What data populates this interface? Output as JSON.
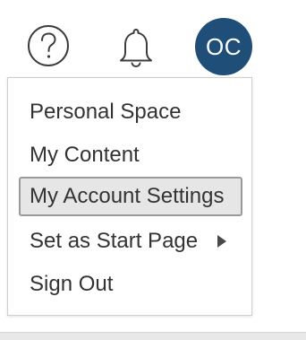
{
  "header": {
    "help_icon": "question-circle-icon",
    "notification_icon": "bell-icon",
    "avatar_initials": "OC",
    "avatar_color": "#1f4e79"
  },
  "menu": {
    "items": [
      {
        "label": "Personal Space"
      },
      {
        "label": "My Content"
      },
      {
        "label": "My Account Settings",
        "highlighted": true
      },
      {
        "label": "Set as Start Page",
        "has_submenu": true
      },
      {
        "label": "Sign Out"
      }
    ],
    "submenu_icon": "triangle-right-icon"
  }
}
